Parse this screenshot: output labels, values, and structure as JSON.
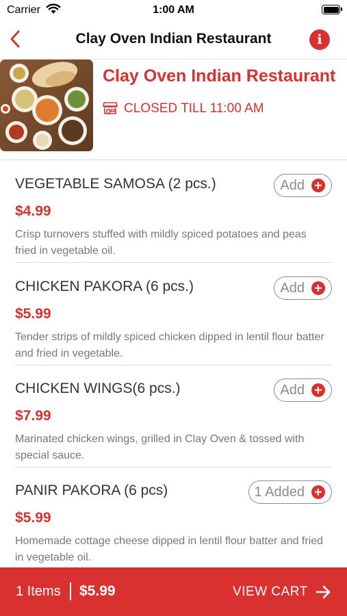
{
  "status_bar": {
    "carrier": "Carrier",
    "time": "1:00 AM"
  },
  "nav": {
    "title": "Clay Oven Indian Restaurant",
    "back_icon": "chevron-left-icon",
    "info_icon": "info-icon",
    "info_glyph": "i"
  },
  "header": {
    "restaurant_name": "Clay Oven Indian Restaurant",
    "status_text": "CLOSED TILL 11:00 AM",
    "status_icon": "store-icon"
  },
  "menu_items": [
    {
      "name": "VEGETABLE SAMOSA (2 pcs.)",
      "price": "$4.99",
      "description": "Crisp turnovers stuffed with mildly spiced potatoes and peas fried in vegetable oil.",
      "button_label": "Add"
    },
    {
      "name": "CHICKEN PAKORA (6 pcs.)",
      "price": "$5.99",
      "description": "Tender strips of mildly spiced chicken dipped in lentil flour batter and fried in vegetable.",
      "button_label": "Add"
    },
    {
      "name": "CHICKEN WINGS(6 pcs.)",
      "price": "$7.99",
      "description": " Marinated chicken wings, grilled in Clay Oven & tossed with special sauce.",
      "button_label": "Add"
    },
    {
      "name": "PANIR PAKORA (6 pcs)",
      "price": "$5.99",
      "description": "Homemade cottage cheese dipped in lentil flour batter and fried in vegetable oil.",
      "button_label": "1 Added"
    }
  ],
  "cart": {
    "items_label": "1 Items",
    "total": "$5.99",
    "view_cart_label": "VIEW CART"
  },
  "colors": {
    "accent": "#d93030",
    "text": "#333333",
    "muted": "#777777",
    "border": "#8a8a8a"
  }
}
